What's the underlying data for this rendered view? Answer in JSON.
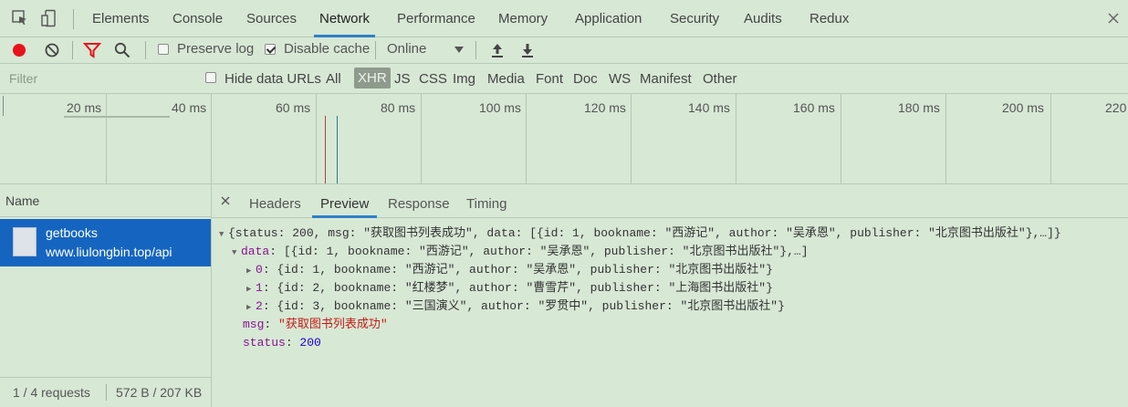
{
  "tabs": [
    "Elements",
    "Console",
    "Sources",
    "Network",
    "Performance",
    "Memory",
    "Application",
    "Security",
    "Audits",
    "Redux"
  ],
  "toolbar": {
    "preserve_log": "Preserve log",
    "disable_cache": "Disable cache",
    "throttle": "Online"
  },
  "filter": {
    "placeholder": "Filter",
    "hide_data_urls": "Hide data URLs",
    "types": [
      "All",
      "XHR",
      "JS",
      "CSS",
      "Img",
      "Media",
      "Font",
      "Doc",
      "WS",
      "Manifest",
      "Other"
    ],
    "selected_type": "XHR"
  },
  "timeline": {
    "ticks": [
      "20 ms",
      "40 ms",
      "60 ms",
      "80 ms",
      "100 ms",
      "120 ms",
      "140 ms",
      "160 ms",
      "180 ms",
      "200 ms",
      "220"
    ]
  },
  "requests": {
    "header": "Name",
    "items": [
      {
        "name": "getbooks",
        "url": "www.liulongbin.top/api"
      }
    ],
    "status_count": "1 / 4 requests",
    "status_size": "572 B / 207 KB"
  },
  "detail": {
    "tabs": [
      "Headers",
      "Preview",
      "Response",
      "Timing"
    ],
    "active": "Preview"
  },
  "preview": {
    "line1": "{status: 200, msg: \"获取图书列表成功\", data: [{id: 1, bookname: \"西游记\", author: \"吴承恩\", publisher: \"北京图书出版社\"},…]}",
    "data_key": "data",
    "data_summary": "[{id: 1, bookname: \"西游记\", author: \"吴承恩\", publisher: \"北京图书出版社\"},…]",
    "items": [
      {
        "index": "0",
        "text": "{id: 1, bookname: \"西游记\", author: \"吴承恩\", publisher: \"北京图书出版社\"}"
      },
      {
        "index": "1",
        "text": "{id: 2, bookname: \"红楼梦\", author: \"曹雪芹\", publisher: \"上海图书出版社\"}"
      },
      {
        "index": "2",
        "text": "{id: 3, bookname: \"三国演义\", author: \"罗贯中\", publisher: \"北京图书出版社\"}"
      }
    ],
    "msg_key": "msg",
    "msg_value": "\"获取图书列表成功\"",
    "status_key": "status",
    "status_value": "200"
  },
  "colors": {
    "background": "#d7e8d5",
    "accent": "#2f80c8",
    "selected_row": "#1565c0",
    "record": "#e8131a"
  }
}
